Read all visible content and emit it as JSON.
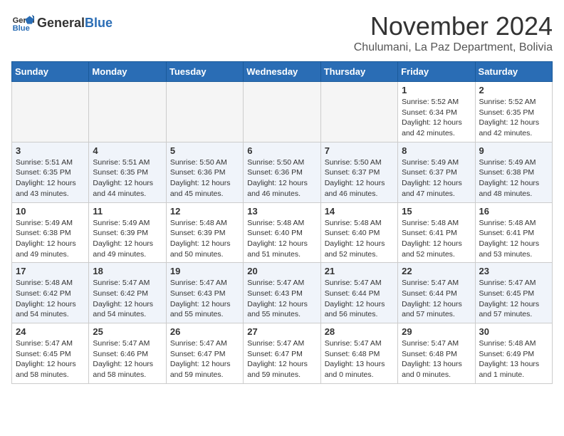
{
  "logo": {
    "text_general": "General",
    "text_blue": "Blue"
  },
  "header": {
    "month": "November 2024",
    "location": "Chulumani, La Paz Department, Bolivia"
  },
  "days_of_week": [
    "Sunday",
    "Monday",
    "Tuesday",
    "Wednesday",
    "Thursday",
    "Friday",
    "Saturday"
  ],
  "weeks": [
    [
      {
        "day": "",
        "info": ""
      },
      {
        "day": "",
        "info": ""
      },
      {
        "day": "",
        "info": ""
      },
      {
        "day": "",
        "info": ""
      },
      {
        "day": "",
        "info": ""
      },
      {
        "day": "1",
        "info": "Sunrise: 5:52 AM\nSunset: 6:34 PM\nDaylight: 12 hours and 42 minutes."
      },
      {
        "day": "2",
        "info": "Sunrise: 5:52 AM\nSunset: 6:35 PM\nDaylight: 12 hours and 42 minutes."
      }
    ],
    [
      {
        "day": "3",
        "info": "Sunrise: 5:51 AM\nSunset: 6:35 PM\nDaylight: 12 hours and 43 minutes."
      },
      {
        "day": "4",
        "info": "Sunrise: 5:51 AM\nSunset: 6:35 PM\nDaylight: 12 hours and 44 minutes."
      },
      {
        "day": "5",
        "info": "Sunrise: 5:50 AM\nSunset: 6:36 PM\nDaylight: 12 hours and 45 minutes."
      },
      {
        "day": "6",
        "info": "Sunrise: 5:50 AM\nSunset: 6:36 PM\nDaylight: 12 hours and 46 minutes."
      },
      {
        "day": "7",
        "info": "Sunrise: 5:50 AM\nSunset: 6:37 PM\nDaylight: 12 hours and 46 minutes."
      },
      {
        "day": "8",
        "info": "Sunrise: 5:49 AM\nSunset: 6:37 PM\nDaylight: 12 hours and 47 minutes."
      },
      {
        "day": "9",
        "info": "Sunrise: 5:49 AM\nSunset: 6:38 PM\nDaylight: 12 hours and 48 minutes."
      }
    ],
    [
      {
        "day": "10",
        "info": "Sunrise: 5:49 AM\nSunset: 6:38 PM\nDaylight: 12 hours and 49 minutes."
      },
      {
        "day": "11",
        "info": "Sunrise: 5:49 AM\nSunset: 6:39 PM\nDaylight: 12 hours and 49 minutes."
      },
      {
        "day": "12",
        "info": "Sunrise: 5:48 AM\nSunset: 6:39 PM\nDaylight: 12 hours and 50 minutes."
      },
      {
        "day": "13",
        "info": "Sunrise: 5:48 AM\nSunset: 6:40 PM\nDaylight: 12 hours and 51 minutes."
      },
      {
        "day": "14",
        "info": "Sunrise: 5:48 AM\nSunset: 6:40 PM\nDaylight: 12 hours and 52 minutes."
      },
      {
        "day": "15",
        "info": "Sunrise: 5:48 AM\nSunset: 6:41 PM\nDaylight: 12 hours and 52 minutes."
      },
      {
        "day": "16",
        "info": "Sunrise: 5:48 AM\nSunset: 6:41 PM\nDaylight: 12 hours and 53 minutes."
      }
    ],
    [
      {
        "day": "17",
        "info": "Sunrise: 5:48 AM\nSunset: 6:42 PM\nDaylight: 12 hours and 54 minutes."
      },
      {
        "day": "18",
        "info": "Sunrise: 5:47 AM\nSunset: 6:42 PM\nDaylight: 12 hours and 54 minutes."
      },
      {
        "day": "19",
        "info": "Sunrise: 5:47 AM\nSunset: 6:43 PM\nDaylight: 12 hours and 55 minutes."
      },
      {
        "day": "20",
        "info": "Sunrise: 5:47 AM\nSunset: 6:43 PM\nDaylight: 12 hours and 55 minutes."
      },
      {
        "day": "21",
        "info": "Sunrise: 5:47 AM\nSunset: 6:44 PM\nDaylight: 12 hours and 56 minutes."
      },
      {
        "day": "22",
        "info": "Sunrise: 5:47 AM\nSunset: 6:44 PM\nDaylight: 12 hours and 57 minutes."
      },
      {
        "day": "23",
        "info": "Sunrise: 5:47 AM\nSunset: 6:45 PM\nDaylight: 12 hours and 57 minutes."
      }
    ],
    [
      {
        "day": "24",
        "info": "Sunrise: 5:47 AM\nSunset: 6:45 PM\nDaylight: 12 hours and 58 minutes."
      },
      {
        "day": "25",
        "info": "Sunrise: 5:47 AM\nSunset: 6:46 PM\nDaylight: 12 hours and 58 minutes."
      },
      {
        "day": "26",
        "info": "Sunrise: 5:47 AM\nSunset: 6:47 PM\nDaylight: 12 hours and 59 minutes."
      },
      {
        "day": "27",
        "info": "Sunrise: 5:47 AM\nSunset: 6:47 PM\nDaylight: 12 hours and 59 minutes."
      },
      {
        "day": "28",
        "info": "Sunrise: 5:47 AM\nSunset: 6:48 PM\nDaylight: 13 hours and 0 minutes."
      },
      {
        "day": "29",
        "info": "Sunrise: 5:47 AM\nSunset: 6:48 PM\nDaylight: 13 hours and 0 minutes."
      },
      {
        "day": "30",
        "info": "Sunrise: 5:48 AM\nSunset: 6:49 PM\nDaylight: 13 hours and 1 minute."
      }
    ]
  ]
}
